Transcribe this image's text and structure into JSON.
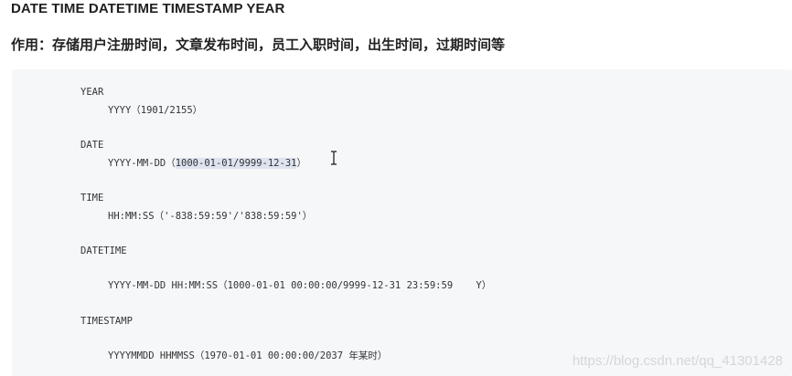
{
  "heading": "DATE TIME DATETIME TIMESTAMP YEAR",
  "subheading": "作用：存储用户注册时间，文章发布时间，员工入职时间，出生时间，过期时间等",
  "code": {
    "year_kw": "YEAR",
    "year_val": "YYYY（1901/2155）",
    "date_kw": "DATE",
    "date_val_prefix": "YYYY-MM-DD（",
    "date_val_selected": "1000-01-01/9999-12-31",
    "date_val_suffix": "）",
    "time_kw": "TIME",
    "time_val": "HH:MM:SS（'-838:59:59'/'838:59:59'）",
    "datetime_kw": "DATETIME",
    "datetime_val": "YYYY-MM-DD HH:MM:SS（1000-01-01 00:00:00/9999-12-31 23:59:59    Y）",
    "timestamp_kw": "TIMESTAMP",
    "timestamp_val": "YYYYMMDD HHMMSS（1970-01-01 00:00:00/2037 年某时）"
  },
  "watermark": "https://blog.csdn.net/qq_41301428",
  "icons": {
    "cursor": "text-cursor-icon"
  }
}
